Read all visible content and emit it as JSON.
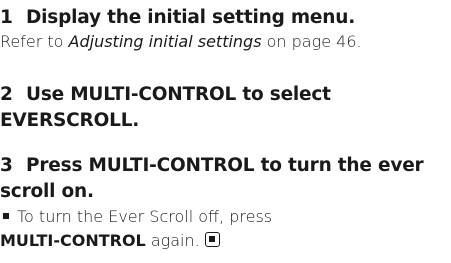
{
  "steps": [
    {
      "number": "1",
      "heading": "Display the initial setting menu.",
      "body_prefix": "Refer to ",
      "body_link": "Adjusting initial settings",
      "body_suffix": " on page 46."
    },
    {
      "number": "2",
      "heading_line1": "Use MULTI-CONTROL to select",
      "heading_line2": "EVERSCROLL."
    },
    {
      "number": "3",
      "heading_line1": "Press MULTI-CONTROL to turn the ever",
      "heading_line2": "scroll on.",
      "note_line1": "To turn the Ever Scroll off, press",
      "note_bold": "MULTI-CONTROL",
      "note_suffix": " again.",
      "end_icon": "end-of-section-icon"
    }
  ]
}
